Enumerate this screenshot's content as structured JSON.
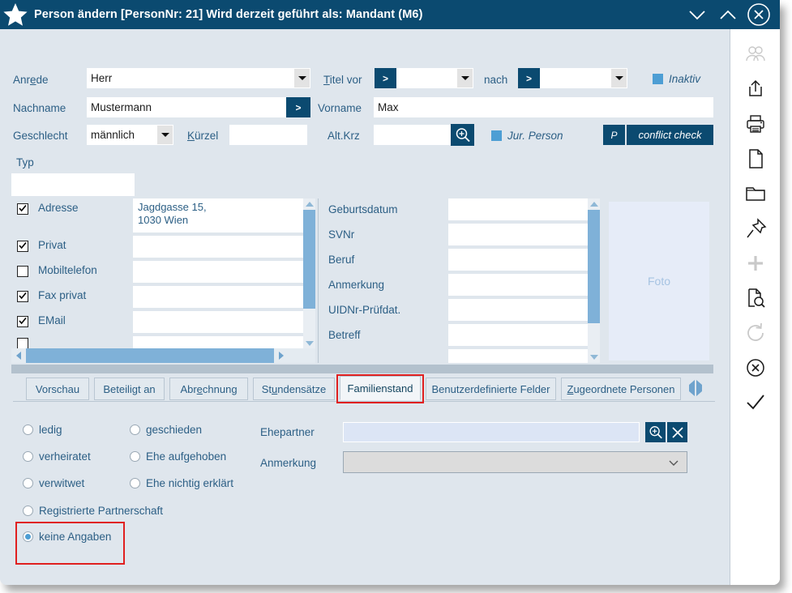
{
  "window": {
    "title": "Person ändern  [PersonNr: 21] Wird derzeit geführt als: Mandant (M6)",
    "star_icon": "star-icon",
    "controls": [
      {
        "name": "minimize-button",
        "icon": "chevron-down-icon"
      },
      {
        "name": "restore-button",
        "icon": "chevron-up-icon"
      },
      {
        "name": "close-button",
        "icon": "circle-x-icon"
      }
    ],
    "accent_navy": "#0b4a70",
    "accent_blue": "#4d9ed4",
    "background": "#dfe6ed",
    "highlight_red": "#e02020"
  },
  "form": {
    "anrede": {
      "label": "Anrede",
      "label_accel": "e",
      "value": "Herr"
    },
    "nachname": {
      "label": "Nachname",
      "value": "Mustermann",
      "button": ">"
    },
    "geschlecht": {
      "label": "Geschlecht",
      "value": "männlich"
    },
    "kuerzel": {
      "label": "Kürzel",
      "label_accel": "K",
      "value": ""
    },
    "titel_vor": {
      "label": "Titel vor",
      "label_accel": "T",
      "value": "",
      "button": ">"
    },
    "titel_nach": {
      "label": "nach",
      "value": "",
      "button": ">"
    },
    "inaktiv": {
      "label": "Inaktiv",
      "checked": true
    },
    "vorname": {
      "label": "Vorname",
      "value": "Max"
    },
    "altkrz": {
      "label": "Alt.Krz",
      "value": "",
      "search_icon": "magnifier-plus-icon"
    },
    "jur_person": {
      "label": "Jur. Person",
      "checked": true
    },
    "p_button": {
      "label": "P"
    },
    "conflict_check": {
      "label": "conflict check"
    },
    "typ": {
      "label": "Typ",
      "value": ""
    }
  },
  "contacts": {
    "rows": [
      {
        "label": "Adresse",
        "checked": true,
        "value": "Jagdgasse 15,\n1030 Wien"
      },
      {
        "label": "Privat",
        "checked": true,
        "value": ""
      },
      {
        "label": "Mobiltelefon",
        "checked": false,
        "value": ""
      },
      {
        "label": "Fax privat",
        "checked": true,
        "value": ""
      },
      {
        "label": "EMail",
        "checked": true,
        "value": ""
      }
    ]
  },
  "details": {
    "rows": [
      {
        "label": "Geburtsdatum",
        "value": ""
      },
      {
        "label": "SVNr",
        "value": ""
      },
      {
        "label": "Beruf",
        "value": ""
      },
      {
        "label": "Anmerkung",
        "value": ""
      },
      {
        "label": "UIDNr-Prüfdat.",
        "value": ""
      },
      {
        "label": "Betreff",
        "value": ""
      }
    ]
  },
  "photo": {
    "placeholder": "Foto"
  },
  "tabs": {
    "items": [
      {
        "label": "Vorschau",
        "active": false
      },
      {
        "label": "Beteiligt an",
        "active": false
      },
      {
        "label": "Abrechnung",
        "active": false
      },
      {
        "label": "Stundensätze",
        "active": false
      },
      {
        "label": "Familienstand",
        "active": true
      },
      {
        "label": "Benutzerdefinierte Felder",
        "active": false
      },
      {
        "label": "Zugeordnete Personen",
        "active": false
      }
    ],
    "prev_icon": "chevron-left-icon",
    "next_icon": "chevron-right-icon"
  },
  "familienstand": {
    "options_col1": [
      {
        "label": "ledig",
        "selected": false
      },
      {
        "label": "verheiratet",
        "selected": false
      },
      {
        "label": "verwitwet",
        "selected": false
      }
    ],
    "options_col2": [
      {
        "label": "geschieden",
        "selected": false
      },
      {
        "label": "Ehe aufgehoben",
        "selected": false
      },
      {
        "label": "Ehe nichtig erklärt",
        "selected": false
      }
    ],
    "options_full": [
      {
        "label": "Registrierte Partnerschaft",
        "selected": false
      },
      {
        "label": "keine Angaben",
        "selected": true
      }
    ],
    "ehepartner": {
      "label": "Ehepartner",
      "value": "",
      "search_icon": "magnifier-plus-icon",
      "clear_icon": "x-icon"
    },
    "anmerkung": {
      "label": "Anmerkung",
      "value": ""
    }
  },
  "rail": {
    "items": [
      {
        "name": "persons-icon",
        "icon": "people-icon",
        "disabled": true
      },
      {
        "name": "export-icon",
        "icon": "share-up-icon",
        "disabled": false
      },
      {
        "name": "print-icon",
        "icon": "printer-icon",
        "disabled": false
      },
      {
        "name": "new-document-icon",
        "icon": "document-icon",
        "disabled": false
      },
      {
        "name": "folder-icon",
        "icon": "folder-icon",
        "disabled": false
      },
      {
        "name": "pin-icon",
        "icon": "pin-icon",
        "disabled": false
      },
      {
        "name": "add-icon",
        "icon": "plus-icon",
        "disabled": true
      },
      {
        "name": "document-search-icon",
        "icon": "document-magnifier-icon",
        "disabled": false
      },
      {
        "name": "refresh-icon",
        "icon": "refresh-icon",
        "disabled": true
      },
      {
        "name": "cancel-icon",
        "icon": "circle-x-icon",
        "disabled": false
      },
      {
        "name": "confirm-icon",
        "icon": "check-icon",
        "disabled": false
      }
    ]
  }
}
